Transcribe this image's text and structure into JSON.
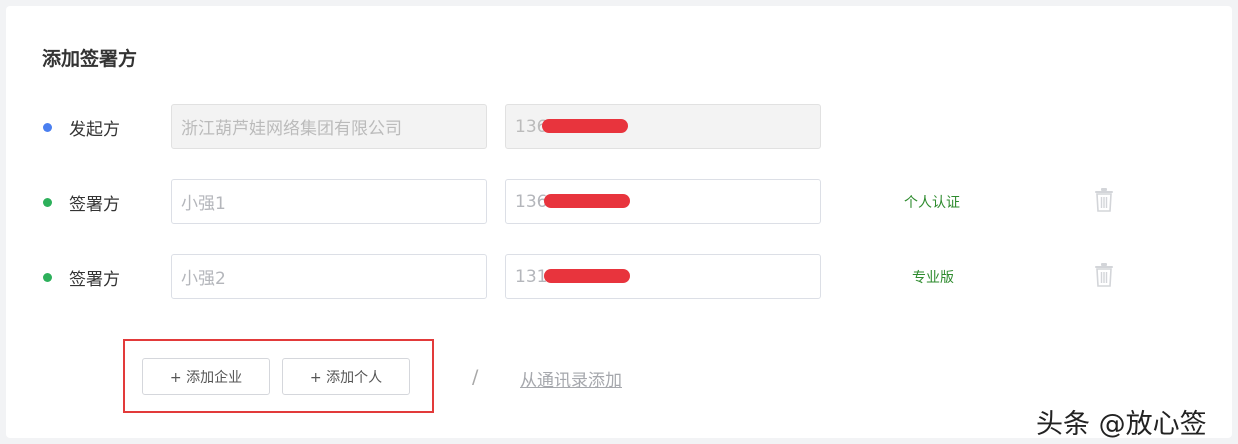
{
  "form": {
    "title": "添加签署方",
    "parties": [
      {
        "role": "发起方",
        "dot_color": "#4a7ff0",
        "company": "浙江葫芦娃网络集团有限公司",
        "phone_visible": "136",
        "disabled": true,
        "auth_type": "",
        "deletable": false
      },
      {
        "role": "签署方",
        "dot_color": "#2db05b",
        "company": "小强1",
        "phone_visible": "136",
        "disabled": false,
        "auth_type": "个人认证",
        "deletable": true
      },
      {
        "role": "签署方",
        "dot_color": "#2db05b",
        "company": "小强2",
        "phone_visible": "131",
        "disabled": false,
        "auth_type": "专业版",
        "deletable": true
      }
    ],
    "actions": {
      "add_company": "+ 添加企业",
      "add_person": "+ 添加个人",
      "separator": "/",
      "from_contacts": "从通讯录添加"
    }
  },
  "watermark": "头条 @放心签",
  "colors": {
    "highlight_box": "#e23a3a",
    "auth_text": "#2e8b2e",
    "redaction": "#e8343d"
  }
}
